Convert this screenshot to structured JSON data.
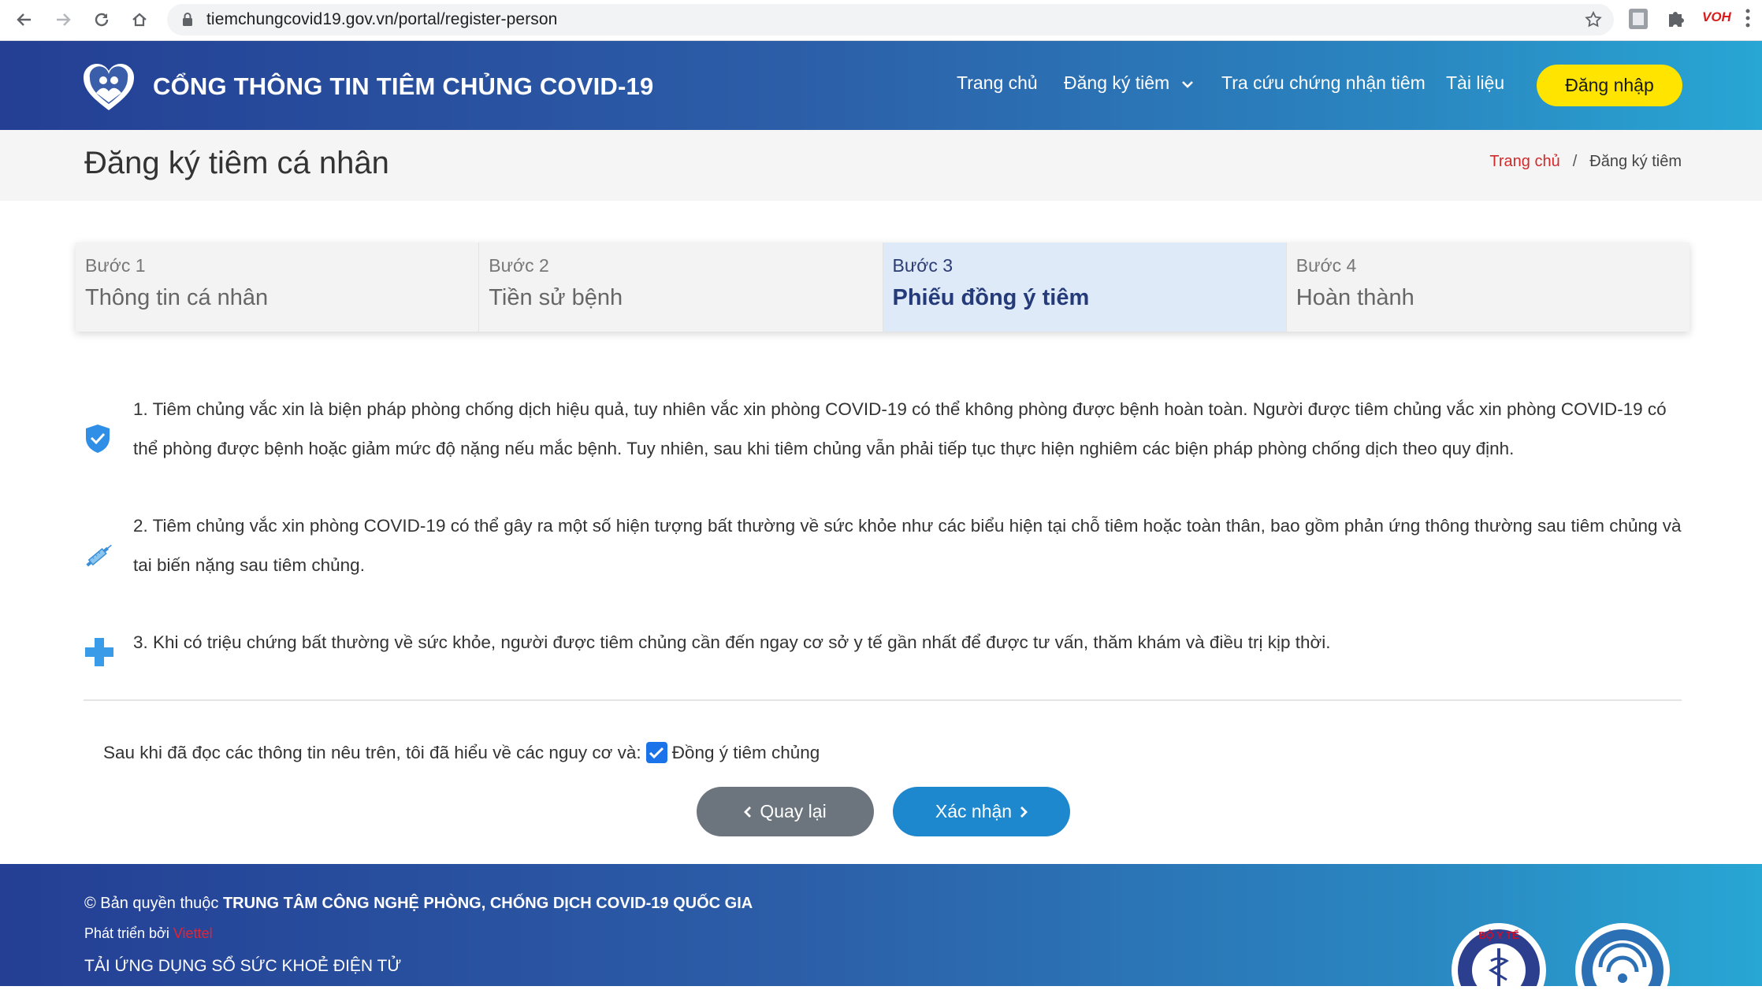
{
  "browser": {
    "url": "tiemchungcovid19.gov.vn/portal/register-person",
    "extension_label": "VOH"
  },
  "header": {
    "site_title": "CỔNG THÔNG TIN TIÊM CHỦNG COVID-19",
    "nav": {
      "home": "Trang chủ",
      "register": "Đăng ký tiêm",
      "lookup": "Tra cứu chứng nhận tiêm",
      "docs": "Tài liệu"
    },
    "login_label": "Đăng nhập"
  },
  "page": {
    "title": "Đăng ký tiêm cá nhân",
    "breadcrumb": {
      "home": "Trang chủ",
      "separator": "/",
      "current": "Đăng ký tiêm"
    }
  },
  "steps": [
    {
      "num": "Bước 1",
      "name": "Thông tin cá nhân",
      "active": false
    },
    {
      "num": "Bước 2",
      "name": "Tiền sử bệnh",
      "active": false
    },
    {
      "num": "Bước 3",
      "name": "Phiếu đồng ý tiêm",
      "active": true
    },
    {
      "num": "Bước 4",
      "name": "Hoàn thành",
      "active": false
    }
  ],
  "notices": [
    {
      "icon": "shield-check-icon",
      "text": "1. Tiêm chủng vắc xin là biện pháp phòng chống dịch hiệu quả, tuy nhiên vắc xin phòng COVID-19 có thể không phòng được bệnh hoàn toàn. Người được tiêm chủng vắc xin phòng COVID-19 có thể phòng được bệnh hoặc giảm mức độ nặng nếu mắc bệnh. Tuy nhiên, sau khi tiêm chủng vẫn phải tiếp tục thực hiện nghiêm các biện pháp phòng chống dịch theo quy định."
    },
    {
      "icon": "syringe-icon",
      "text": "2. Tiêm chủng vắc xin phòng COVID-19 có thể gây ra một số hiện tượng bất thường về sức khỏe như các biểu hiện tại chỗ tiêm hoặc toàn thân, bao gồm phản ứng thông thường sau tiêm chủng và tai biến nặng sau tiêm chủng."
    },
    {
      "icon": "medical-cross-icon",
      "text": "3. Khi có triệu chứng bất thường về sức khỏe, người được tiêm chủng cần đến ngay cơ sở y tế gần nhất để được tư vấn, thăm khám và điều trị kịp thời."
    }
  ],
  "consent": {
    "prefix": "Sau khi đã đọc các thông tin nêu trên, tôi đã hiểu về các nguy cơ và:",
    "checkbox_label": "Đồng ý tiêm chủng",
    "checked": true
  },
  "buttons": {
    "back": "Quay lại",
    "confirm": "Xác nhận"
  },
  "footer": {
    "copyright_prefix": "© Bản quyền thuộc ",
    "copyright_org": "TRUNG TÂM CÔNG NGHỆ PHÒNG, CHỐNG DỊCH COVID-19 QUỐC GIA",
    "developed_by": "Phát triển bởi ",
    "developer": "Viettel",
    "app_download": "TẢI ỨNG DỤNG SỔ SỨC KHOẺ ĐIỆN TỬ",
    "seal_text": "BỘ Y TẾ"
  },
  "colors": {
    "header_start": "#243f94",
    "header_end": "#28a6d4",
    "login_button": "#ffe400",
    "active_step": "#deeaf8",
    "confirm_button": "#1e88cf",
    "back_button": "#6c757d",
    "breadcrumb_home": "#d12a2a"
  }
}
